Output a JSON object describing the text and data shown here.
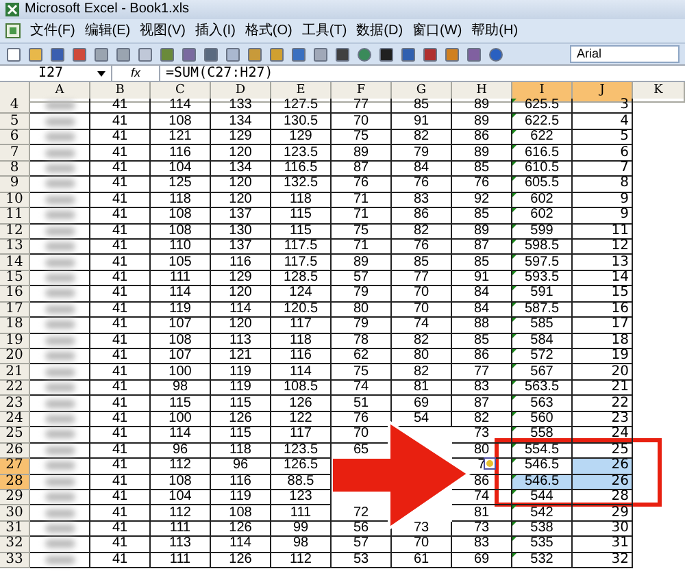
{
  "window": {
    "title": "Microsoft Excel - Book1.xls"
  },
  "menu": [
    "文件(F)",
    "编辑(E)",
    "视图(V)",
    "插入(I)",
    "格式(O)",
    "工具(T)",
    "数据(D)",
    "窗口(W)",
    "帮助(H)"
  ],
  "font_box": {
    "value": "Arial"
  },
  "formula_bar": {
    "name_box": "I27",
    "fx": "fx",
    "formula": "=SUM(C27:H27)"
  },
  "columns": [
    {
      "label": "A",
      "selected": false,
      "text_numbers": false
    },
    {
      "label": "B",
      "selected": false,
      "text_numbers": false
    },
    {
      "label": "C",
      "selected": false,
      "text_numbers": false
    },
    {
      "label": "D",
      "selected": false,
      "text_numbers": false
    },
    {
      "label": "E",
      "selected": false,
      "text_numbers": false
    },
    {
      "label": "F",
      "selected": false,
      "text_numbers": false
    },
    {
      "label": "G",
      "selected": false,
      "text_numbers": false
    },
    {
      "label": "H",
      "selected": false,
      "text_numbers": false
    },
    {
      "label": "I",
      "selected": true,
      "text_numbers": true
    },
    {
      "label": "J",
      "selected": true,
      "text_numbers": false
    },
    {
      "label": "K",
      "selected": false,
      "text_numbers": false
    }
  ],
  "rows": [
    {
      "label": "4",
      "selected": false,
      "cells": [
        "41",
        "114",
        "133",
        "127.5",
        "77",
        "85",
        "89",
        "625.5",
        "3"
      ]
    },
    {
      "label": "5",
      "selected": false,
      "cells": [
        "41",
        "108",
        "134",
        "130.5",
        "70",
        "91",
        "89",
        "622.5",
        "4"
      ]
    },
    {
      "label": "6",
      "selected": false,
      "cells": [
        "41",
        "121",
        "129",
        "129",
        "75",
        "82",
        "86",
        "622",
        "5"
      ]
    },
    {
      "label": "7",
      "selected": false,
      "cells": [
        "41",
        "116",
        "120",
        "123.5",
        "89",
        "79",
        "89",
        "616.5",
        "6"
      ]
    },
    {
      "label": "8",
      "selected": false,
      "cells": [
        "41",
        "104",
        "134",
        "116.5",
        "87",
        "84",
        "85",
        "610.5",
        "7"
      ]
    },
    {
      "label": "9",
      "selected": false,
      "cells": [
        "41",
        "125",
        "120",
        "132.5",
        "76",
        "76",
        "76",
        "605.5",
        "8"
      ]
    },
    {
      "label": "10",
      "selected": false,
      "cells": [
        "41",
        "118",
        "120",
        "118",
        "71",
        "83",
        "92",
        "602",
        "9"
      ]
    },
    {
      "label": "11",
      "selected": false,
      "cells": [
        "41",
        "108",
        "137",
        "115",
        "71",
        "86",
        "85",
        "602",
        "9"
      ]
    },
    {
      "label": "12",
      "selected": false,
      "cells": [
        "41",
        "108",
        "130",
        "115",
        "75",
        "82",
        "89",
        "599",
        "11"
      ]
    },
    {
      "label": "13",
      "selected": false,
      "cells": [
        "41",
        "110",
        "137",
        "117.5",
        "71",
        "76",
        "87",
        "598.5",
        "12"
      ]
    },
    {
      "label": "14",
      "selected": false,
      "cells": [
        "41",
        "105",
        "116",
        "117.5",
        "89",
        "85",
        "85",
        "597.5",
        "13"
      ]
    },
    {
      "label": "15",
      "selected": false,
      "cells": [
        "41",
        "111",
        "129",
        "128.5",
        "57",
        "77",
        "91",
        "593.5",
        "14"
      ]
    },
    {
      "label": "16",
      "selected": false,
      "cells": [
        "41",
        "114",
        "120",
        "124",
        "79",
        "70",
        "84",
        "591",
        "15"
      ]
    },
    {
      "label": "17",
      "selected": false,
      "cells": [
        "41",
        "119",
        "114",
        "120.5",
        "80",
        "70",
        "84",
        "587.5",
        "16"
      ]
    },
    {
      "label": "18",
      "selected": false,
      "cells": [
        "41",
        "107",
        "120",
        "117",
        "79",
        "74",
        "88",
        "585",
        "17"
      ]
    },
    {
      "label": "19",
      "selected": false,
      "cells": [
        "41",
        "108",
        "113",
        "118",
        "78",
        "82",
        "85",
        "584",
        "18"
      ]
    },
    {
      "label": "20",
      "selected": false,
      "cells": [
        "41",
        "107",
        "121",
        "116",
        "62",
        "80",
        "86",
        "572",
        "19"
      ]
    },
    {
      "label": "21",
      "selected": false,
      "cells": [
        "41",
        "100",
        "119",
        "114",
        "75",
        "82",
        "77",
        "567",
        "20"
      ]
    },
    {
      "label": "22",
      "selected": false,
      "cells": [
        "41",
        "98",
        "119",
        "108.5",
        "74",
        "81",
        "83",
        "563.5",
        "21"
      ]
    },
    {
      "label": "23",
      "selected": false,
      "cells": [
        "41",
        "115",
        "115",
        "126",
        "51",
        "69",
        "87",
        "563",
        "22"
      ]
    },
    {
      "label": "24",
      "selected": false,
      "cells": [
        "41",
        "100",
        "126",
        "122",
        "76",
        "54",
        "82",
        "560",
        "23"
      ]
    },
    {
      "label": "25",
      "selected": false,
      "cells": [
        "41",
        "114",
        "115",
        "117",
        "70",
        null,
        "73",
        "558",
        "24"
      ]
    },
    {
      "label": "26",
      "selected": false,
      "cells": [
        "41",
        "96",
        "118",
        "123.5",
        "65",
        null,
        "80",
        "554.5",
        "25"
      ]
    },
    {
      "label": "27",
      "selected": true,
      "cells": [
        "41",
        "112",
        "96",
        "126.5",
        null,
        null,
        "7",
        "546.5",
        "26"
      ]
    },
    {
      "label": "28",
      "selected": true,
      "cells": [
        "41",
        "108",
        "116",
        "88.5",
        null,
        null,
        "86",
        "546.5",
        "26"
      ]
    },
    {
      "label": "29",
      "selected": false,
      "cells": [
        "41",
        "104",
        "119",
        "123",
        null,
        null,
        "74",
        "544",
        "28"
      ]
    },
    {
      "label": "30",
      "selected": false,
      "cells": [
        "41",
        "112",
        "108",
        "111",
        "72",
        null,
        "81",
        "542",
        "29"
      ]
    },
    {
      "label": "31",
      "selected": false,
      "cells": [
        "41",
        "111",
        "126",
        "99",
        "56",
        "73",
        "73",
        "538",
        "30"
      ]
    },
    {
      "label": "32",
      "selected": false,
      "cells": [
        "41",
        "113",
        "114",
        "98",
        "57",
        "70",
        "83",
        "535",
        "31"
      ]
    },
    {
      "label": "33",
      "selected": false,
      "cells": [
        "41",
        "111",
        "126",
        "112",
        "53",
        "61",
        "69",
        "532",
        "32"
      ]
    }
  ]
}
